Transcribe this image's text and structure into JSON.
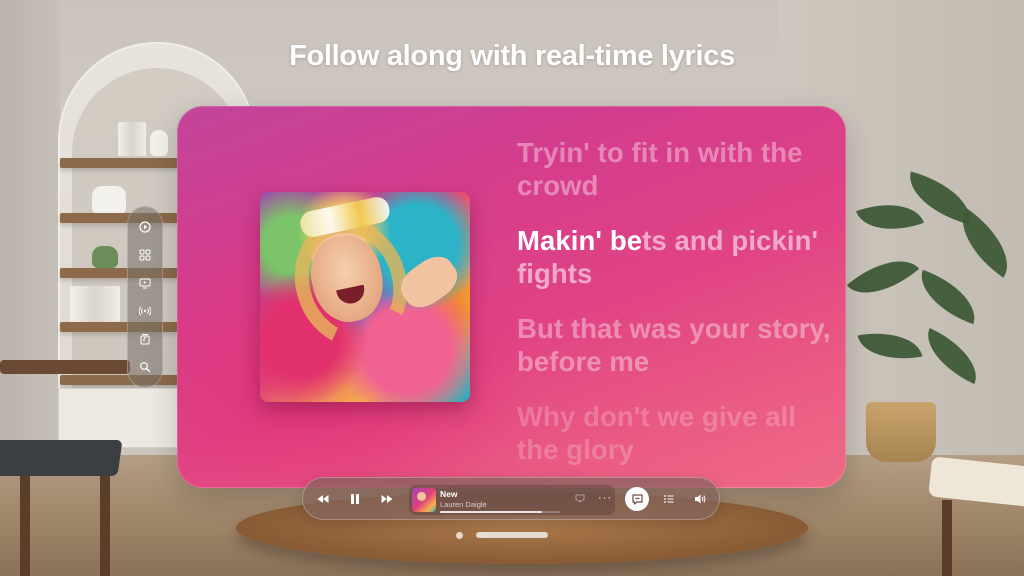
{
  "headline": "Follow along with real-time lyrics",
  "tab_bar": {
    "items": [
      {
        "name": "listen-now",
        "icon": "play-circle-icon"
      },
      {
        "name": "browse",
        "icon": "grid-icon"
      },
      {
        "name": "videos",
        "icon": "tv-icon"
      },
      {
        "name": "radio",
        "icon": "radio-waves-icon"
      },
      {
        "name": "library",
        "icon": "library-icon"
      },
      {
        "name": "search",
        "icon": "search-icon"
      }
    ]
  },
  "lyrics": {
    "lines": [
      {
        "state": "past",
        "text": "Tryin' to fit in with the crowd"
      },
      {
        "state": "current",
        "sung": "Makin' be",
        "unsung": "ts and pickin' fights"
      },
      {
        "state": "next",
        "text": "But that was your story, before me"
      },
      {
        "state": "faded",
        "text": "Why don't we give all the glory"
      }
    ]
  },
  "player": {
    "controls": {
      "rewind": "rewind-icon",
      "pause": "pause-icon",
      "forward": "fast-forward-icon"
    },
    "now_playing": {
      "title": "New",
      "artist": "Lauren Daigle",
      "progress": 0.85
    },
    "more_label": "···",
    "extra": {
      "lyrics": "lyrics-bubble-icon",
      "queue": "list-icon",
      "volume": "speaker-icon"
    }
  },
  "colors": {
    "window_gradient_start": "#c2449a",
    "window_gradient_end": "#ef6a86",
    "active_lyric": "#ffffff"
  }
}
